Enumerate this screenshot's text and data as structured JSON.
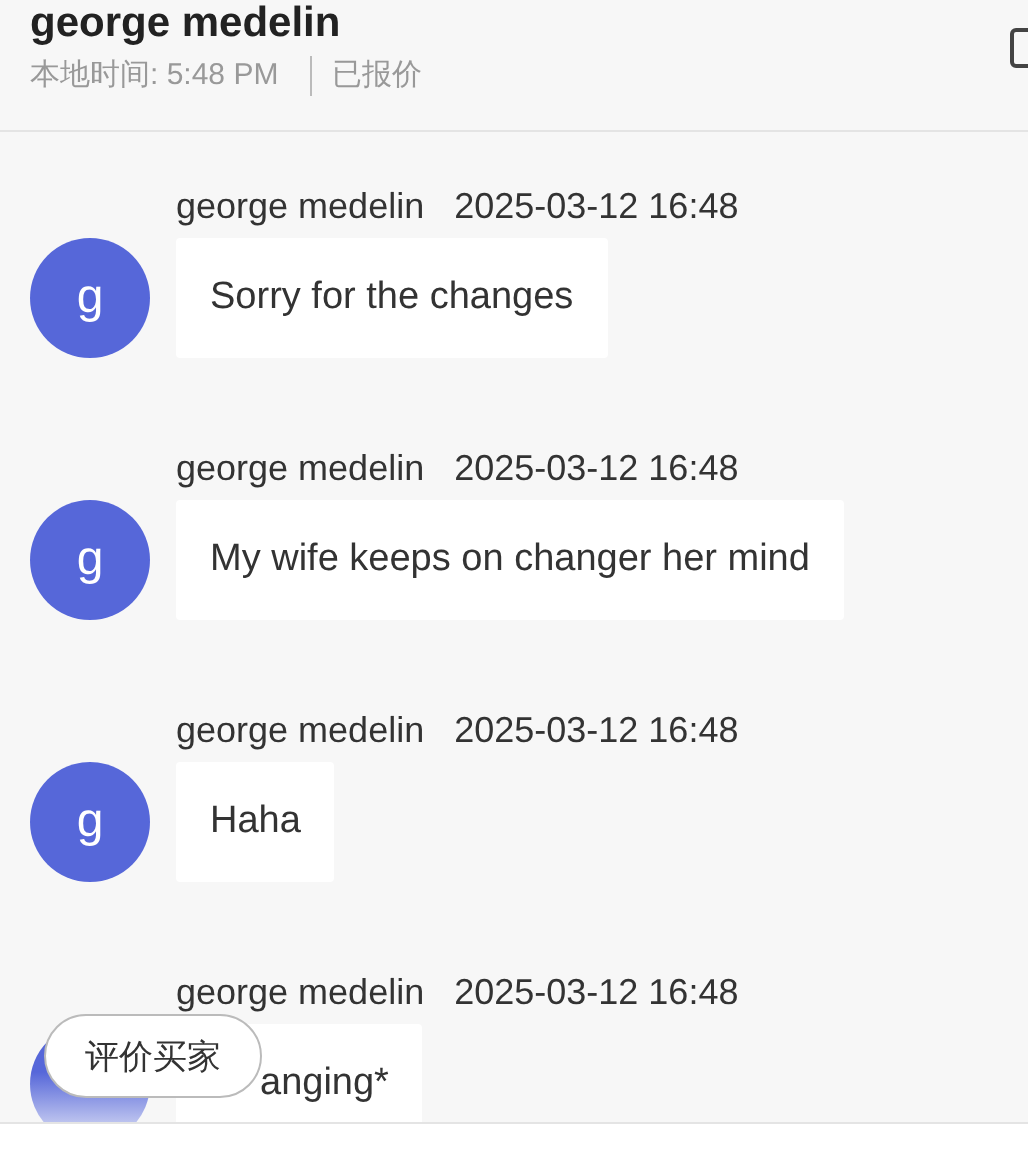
{
  "header": {
    "name": "george medelin",
    "local_time": "本地时间: 5:48 PM",
    "status": "已报价"
  },
  "messages": [
    {
      "sender": "george medelin",
      "time": "2025-03-12 16:48",
      "avatar": "g",
      "text": "Sorry for the changes",
      "covered": false
    },
    {
      "sender": "george medelin",
      "time": "2025-03-12 16:48",
      "avatar": "g",
      "text": "My wife keeps on changer her mind",
      "covered": false
    },
    {
      "sender": "george medelin",
      "time": "2025-03-12 16:48",
      "avatar": "g",
      "text": "Haha",
      "covered": false
    },
    {
      "sender": "george medelin",
      "time": "2025-03-12 16:48",
      "text": "anging*",
      "covered": true
    }
  ],
  "rate_button": "评价买家"
}
